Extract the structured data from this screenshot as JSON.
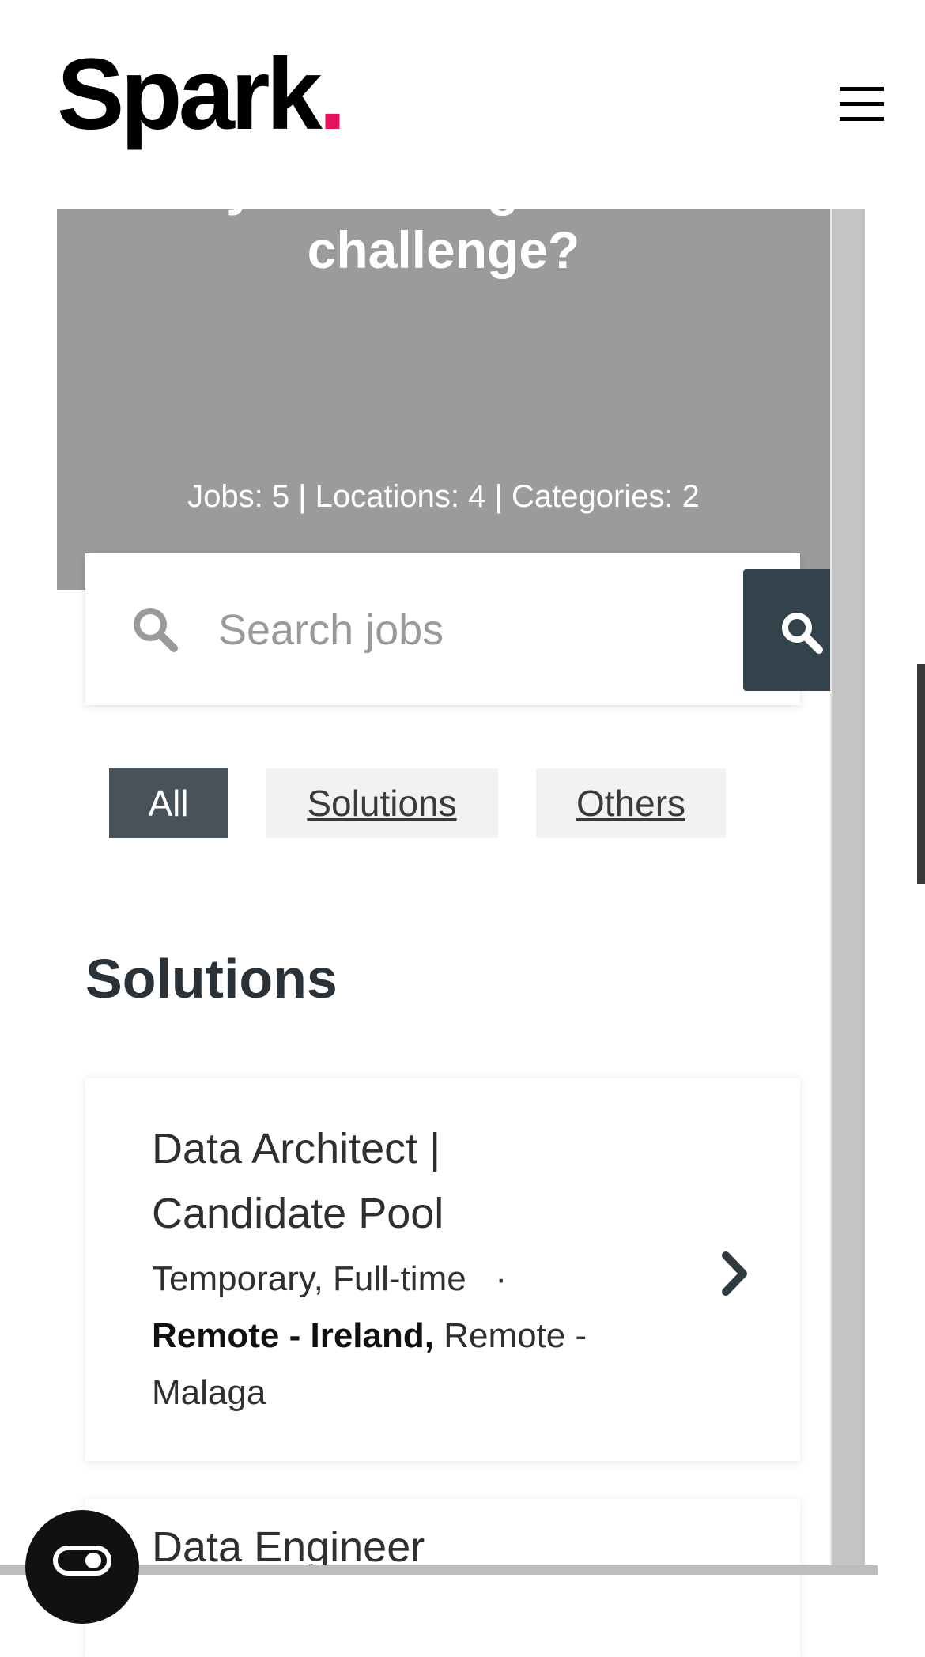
{
  "header": {
    "logo_text": "Spark",
    "logo_dot": ".",
    "accent_color": "#e5105f",
    "menu_icon": "hamburger-menu-icon"
  },
  "hero": {
    "title": "Are you looking for a new challenge?",
    "stats": "Jobs: 5 | Locations: 4 | Categories: 2",
    "background_color": "#9b9b9b"
  },
  "search": {
    "placeholder": "Search jobs",
    "value": "",
    "icon": "search-icon",
    "button_icon": "search-icon",
    "button_color": "#33434b"
  },
  "filters": [
    {
      "label": "All",
      "active": true
    },
    {
      "label": "Solutions",
      "active": false
    },
    {
      "label": "Others",
      "active": false
    }
  ],
  "section": {
    "title": "Solutions"
  },
  "jobs": [
    {
      "title": "Data Architect | Candidate Pool",
      "type": "Temporary, Full-time",
      "separator": "·",
      "primary_location": "Remote - Ireland,",
      "other_locations": "Remote - Malaga",
      "icon": "chevron-right-icon"
    },
    {
      "title": "Data Engineer"
    }
  ],
  "fab": {
    "icon": "toggle-icon"
  }
}
